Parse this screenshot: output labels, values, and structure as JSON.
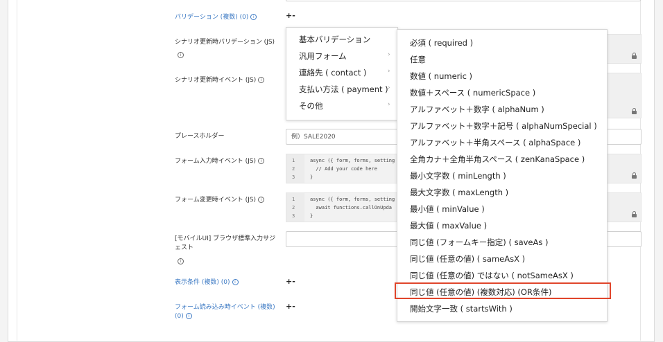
{
  "form": {
    "validation_label": "バリデーション (複数) (0)",
    "scenario_validation_label": "シナリオ更新時バリデーション (JS)",
    "scenario_event_label": "シナリオ更新時イベント (JS)",
    "placeholder_label": "プレースホルダー",
    "placeholder_value": "例）SALE2020",
    "input_event_label": "フォーム入力時イベント (JS)",
    "change_event_label": "フォーム変更時イベント (JS)",
    "mobile_label_line1": "[モバイルUI] ブラウザ標準入力サジ",
    "mobile_label_line2": "ェスト",
    "display_condition_label": "表示条件 (複数) (0)",
    "load_event_label": "フォーム読み込み時イベント (複数)",
    "load_event_count": "(0)",
    "plus_minus": "+-"
  },
  "code_input": {
    "lines": [
      "1",
      "2",
      "3"
    ],
    "line1": "async ({ form, forms, setting",
    "line2": "  // Add your code here",
    "line3": "}"
  },
  "code_change": {
    "lines": [
      "1",
      "2",
      "3"
    ],
    "line1": "async ({ form, forms, setting",
    "line2": "  await functions.callOnUpda",
    "line3": "}"
  },
  "menu_left": {
    "items": [
      "基本バリデーション",
      "汎用フォーム",
      "連絡先 ( contact )",
      "支払い方法 ( payment )",
      "その他"
    ]
  },
  "menu_right": {
    "items": [
      "必須 ( required )",
      "任意",
      "数値 ( numeric )",
      "数値＋スペース ( numericSpace )",
      "アルファベット＋数字 ( alphaNum )",
      "アルファベット＋数字＋記号 ( alphaNumSpecial )",
      "アルファベット＋半角スペース ( alphaSpace )",
      "全角カナ＋全角半角スペース ( zenKanaSpace )",
      "最小文字数 ( minLength )",
      "最大文字数 ( maxLength )",
      "最小値 ( minValue )",
      "最大値 ( maxValue )",
      "同じ値 (フォームキー指定) ( saveAs )",
      "同じ値 (任意の値) ( sameAsX )",
      "同じ値 (任意の値) ではない ( notSameAsX )",
      "同じ値 (任意の値) (複数対応) (OR条件)",
      "開始文字一致 ( startsWith )"
    ]
  },
  "colors": {
    "link": "#3a78c3",
    "highlight": "#e0452b"
  }
}
